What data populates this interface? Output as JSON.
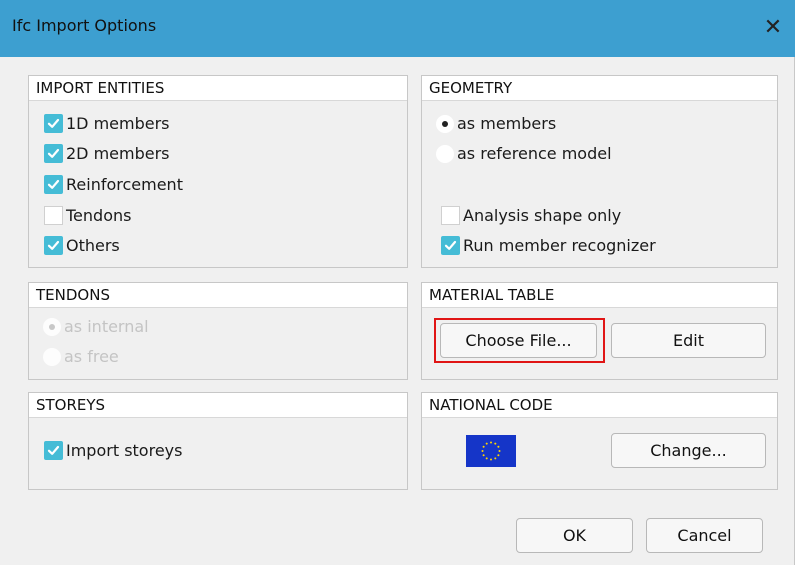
{
  "dialog": {
    "title": "Ifc Import Options",
    "close_glyph": "✕",
    "title_bar_color": "#3d9fd0"
  },
  "import_entities": {
    "title": "IMPORT ENTITIES",
    "items": [
      {
        "label": "1D members",
        "checked": true
      },
      {
        "label": "2D members",
        "checked": true
      },
      {
        "label": "Reinforcement",
        "checked": true
      },
      {
        "label": "Tendons",
        "checked": false
      },
      {
        "label": "Others",
        "checked": true
      }
    ]
  },
  "geometry": {
    "title": "GEOMETRY",
    "options": [
      {
        "label": "as members",
        "selected": true
      },
      {
        "label": "as reference model",
        "selected": false
      }
    ],
    "analysis_shape_only": {
      "label": "Analysis shape only",
      "checked": false
    },
    "run_member_recognizer": {
      "label": "Run member recognizer",
      "checked": true
    }
  },
  "tendons": {
    "title": "TENDONS",
    "options": [
      {
        "label": "as internal",
        "selected": true,
        "disabled": true
      },
      {
        "label": "as free",
        "selected": false,
        "disabled": true
      }
    ]
  },
  "material_table": {
    "title": "MATERIAL TABLE",
    "choose_file_label": "Choose File...",
    "edit_label": "Edit"
  },
  "storeys": {
    "title": "STOREYS",
    "import_storeys": {
      "label": "Import storeys",
      "checked": true
    }
  },
  "national_code": {
    "title": "NATIONAL CODE",
    "flag_icon": "eu-flag-icon",
    "change_label": "Change..."
  },
  "footer": {
    "ok_label": "OK",
    "cancel_label": "Cancel"
  },
  "colors": {
    "checkbox_accent": "#45bcd6",
    "highlight": "#e01515",
    "flag_blue": "#1535c8",
    "flag_stars": "#ffd400"
  }
}
